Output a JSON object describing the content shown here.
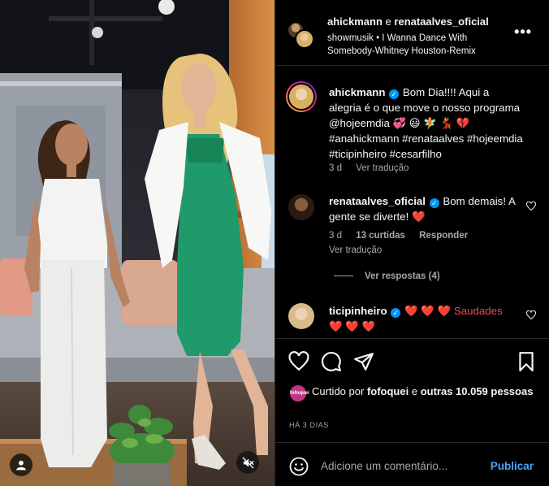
{
  "header": {
    "user1": "ahickmann",
    "joiner": "e",
    "user2": "renataalves_oficial",
    "audio": "showmusik • I Wanna Dance With Somebody-Whitney Houston-Remix",
    "more_label": "•••"
  },
  "caption": {
    "username": "ahickmann",
    "text": "Bom Dia!!!! Aqui a alegria é o que move o nosso programa @hojeemdia 💞 😃 🧚 💃 💔 #anahickmann #renataalves #hojeemdia #ticipinheiro #cesarfilho",
    "time": "3 d",
    "translate": "Ver tradução"
  },
  "comments": [
    {
      "username": "renataalves_oficial",
      "text": "Bom demais! A gente se diverte! ❤️",
      "time": "3 d",
      "likes": "13 curtidas",
      "reply": "Responder",
      "translate": "Ver tradução",
      "replies": "Ver respostas (4)"
    },
    {
      "username": "ticipinheiro",
      "text": "❤️ ❤️ ❤️ Saudades ❤️ ❤️ ❤️"
    }
  ],
  "likes": {
    "avatar_label": "fofoquei",
    "prefix": "Curtido por",
    "liker": "fofoquei",
    "joiner": "e",
    "others": "outras 10.059 pessoas"
  },
  "date": "HÁ 3 DIAS",
  "add_comment": {
    "placeholder": "Adicione um comentário...",
    "post": "Publicar"
  },
  "colors": {
    "accent": "#0095f6",
    "link": "#4da3ff",
    "muted": "#a8a8a8",
    "heart": "#ed4956"
  }
}
